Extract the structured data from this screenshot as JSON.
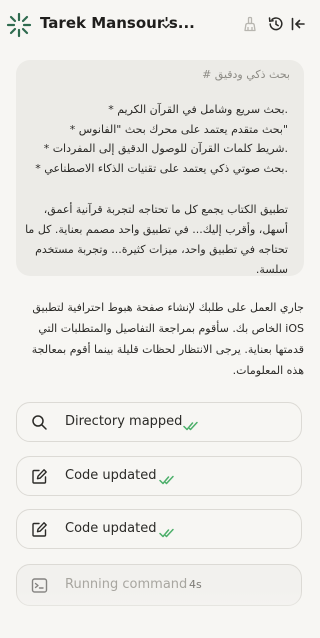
{
  "header": {
    "workspace_title": "Tarek Mansour's...",
    "logo_icon": "eight-point-star-logo",
    "chevron_icon": "chevron-down-icon",
    "broom_icon": "broom-icon",
    "history_icon": "history-icon",
    "collapse_icon": "collapse-panel-icon"
  },
  "prompt": {
    "hash_line": "بحث ذكي ودقيق #",
    "bullets": [
      ".بحث سريع وشامل في القرآن الكريم *",
      "\"بحث متقدم يعتمد على محرك بحث \"الفانوس *",
      ".شريط كلمات القرآن للوصول الدقيق إلى المفردات *",
      ".بحث صوتي ذكي يعتمد على تقنيات الذكاء الاصطناعي *"
    ],
    "paragraph": "تطبيق الكتاب يجمع كل ما تحتاجه لتجربة قرآنية أعمق، أسهل، وأقرب إليك... في تطبيق واحد مصمم بعناية. كل ما تحتاجه في تطبيق واحد، ميزات كثيرة... وتجربة مستخدم سلسة."
  },
  "reply": {
    "text": "جاري العمل على طلبك لإنشاء صفحة هبوط احترافية لتطبيق iOS الخاص بك. سأقوم بمراجعة التفاصيل والمتطلبات التي قدمتها بعناية. يرجى الانتظار لحظات قليلة بينما أقوم بمعالجة هذه المعلومات."
  },
  "steps": [
    {
      "label": "Directory mapped",
      "icon": "search-icon",
      "status_icon": "double-check-icon"
    },
    {
      "label": "Code updated",
      "icon": "edit-file-icon",
      "status_icon": "double-check-icon"
    },
    {
      "label": "Code updated",
      "icon": "edit-file-icon",
      "status_icon": "double-check-icon"
    }
  ],
  "running": {
    "label": "Running command",
    "time": "4s",
    "icon": "terminal-icon"
  },
  "colors": {
    "background": "#f7f6f3",
    "prompt_bubble": "#ecebe7",
    "check_green": "#4caf6a",
    "logo_green": "#2f6b4f"
  }
}
